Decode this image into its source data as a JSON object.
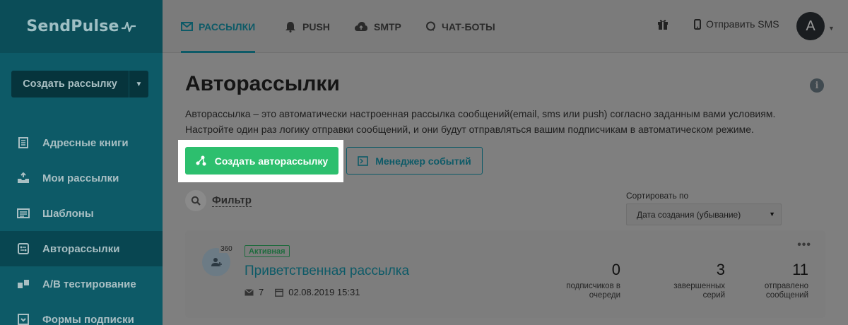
{
  "sidebar": {
    "logo": "SendPulse",
    "create_button": "Создать рассылку",
    "items": [
      {
        "label": "Адресные книги",
        "icon": "address-book-icon"
      },
      {
        "label": "Мои рассылки",
        "icon": "inbox-icon"
      },
      {
        "label": "Шаблоны",
        "icon": "template-icon"
      },
      {
        "label": "Авторассылки",
        "icon": "automation-icon",
        "active": true
      },
      {
        "label": "A/B тестирование",
        "icon": "ab-test-icon"
      },
      {
        "label": "Формы подписки",
        "icon": "subscription-form-icon"
      }
    ]
  },
  "topbar": {
    "tabs": [
      {
        "label": "РАССЫЛКИ",
        "icon": "envelope-icon",
        "active": true
      },
      {
        "label": "PUSH",
        "icon": "bell-icon"
      },
      {
        "label": "SMTP",
        "icon": "cloud-upload-icon"
      },
      {
        "label": "ЧАТ-БОТЫ",
        "icon": "chat-icon"
      }
    ],
    "sms_label": "Отправить SMS",
    "avatar_letter": "A"
  },
  "main": {
    "title": "Авторассылки",
    "description_line1": "Авторассылка – это автоматически настроенная рассылка сообщений(email, sms или push) согласно заданным вами условиям.",
    "description_line2": "Настройте один раз логику отправки сообщений, и они будут отправляться вашим подписчикам в автоматическом режиме.",
    "create_button": "Создать авторассылку",
    "events_button": "Менеджер событий",
    "filter_label": "Фильтр",
    "sort_label": "Сортировать по",
    "sort_value": "Дата создания (убывание)"
  },
  "card": {
    "count": "360",
    "status": "Активная",
    "title": "Приветственная рассылка",
    "messages": "7",
    "date": "02.08.2019 15:31",
    "stats": [
      {
        "value": "0",
        "label_line1": "подписчиков в",
        "label_line2": "очереди"
      },
      {
        "value": "3",
        "label_line1": "завершенных",
        "label_line2": "серий"
      },
      {
        "value": "11",
        "label_line1": "отправлено",
        "label_line2": "сообщений"
      }
    ]
  },
  "colors": {
    "sidebar_bg": "#0d5a67",
    "primary_green": "#2dbf6e",
    "brand_teal": "#0d5a67"
  }
}
